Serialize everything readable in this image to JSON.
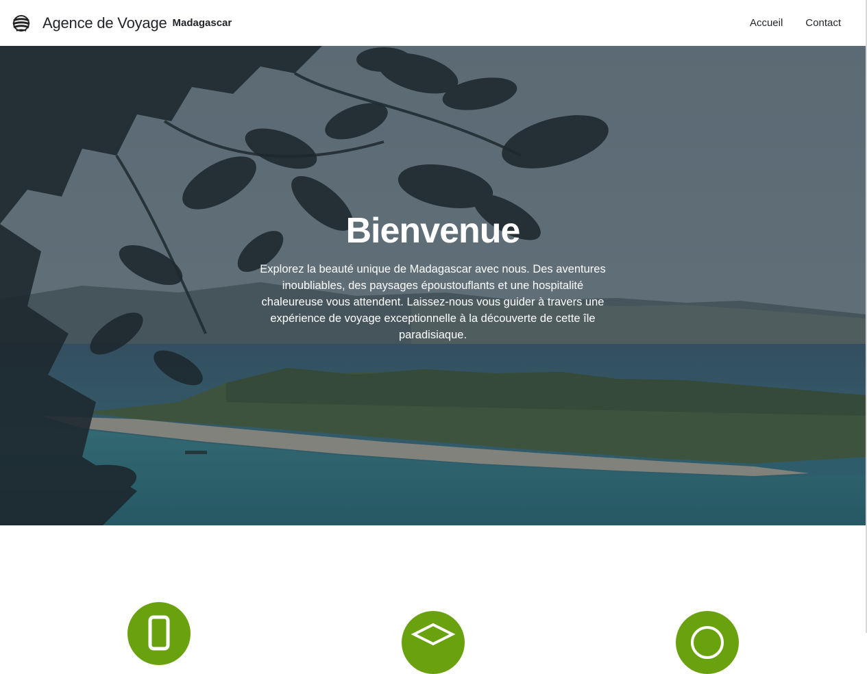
{
  "navbar": {
    "brand_name": "Agence de Voyage",
    "brand_sub": "Madagascar",
    "links": [
      {
        "label": "Accueil"
      },
      {
        "label": "Contact"
      }
    ]
  },
  "hero": {
    "title": "Bienvenue",
    "text": "Explorez la beauté unique de Madagascar avec nous. Des aventures inoubliables, des paysages époustouflants et une hospitalité chaleureuse vous attendent. Laissez-nous vous guider à travers une expérience de voyage exceptionnelle à la découverte de cette île paradisiaque."
  },
  "services": {
    "accent_color": "#6aa10f",
    "icons": [
      "phone-icon",
      "graduation-cap-icon",
      "globe-icon"
    ]
  },
  "colors": {
    "navbar_bg": "#ffffff",
    "text_dark": "#212529",
    "hero_text": "#ffffff"
  }
}
